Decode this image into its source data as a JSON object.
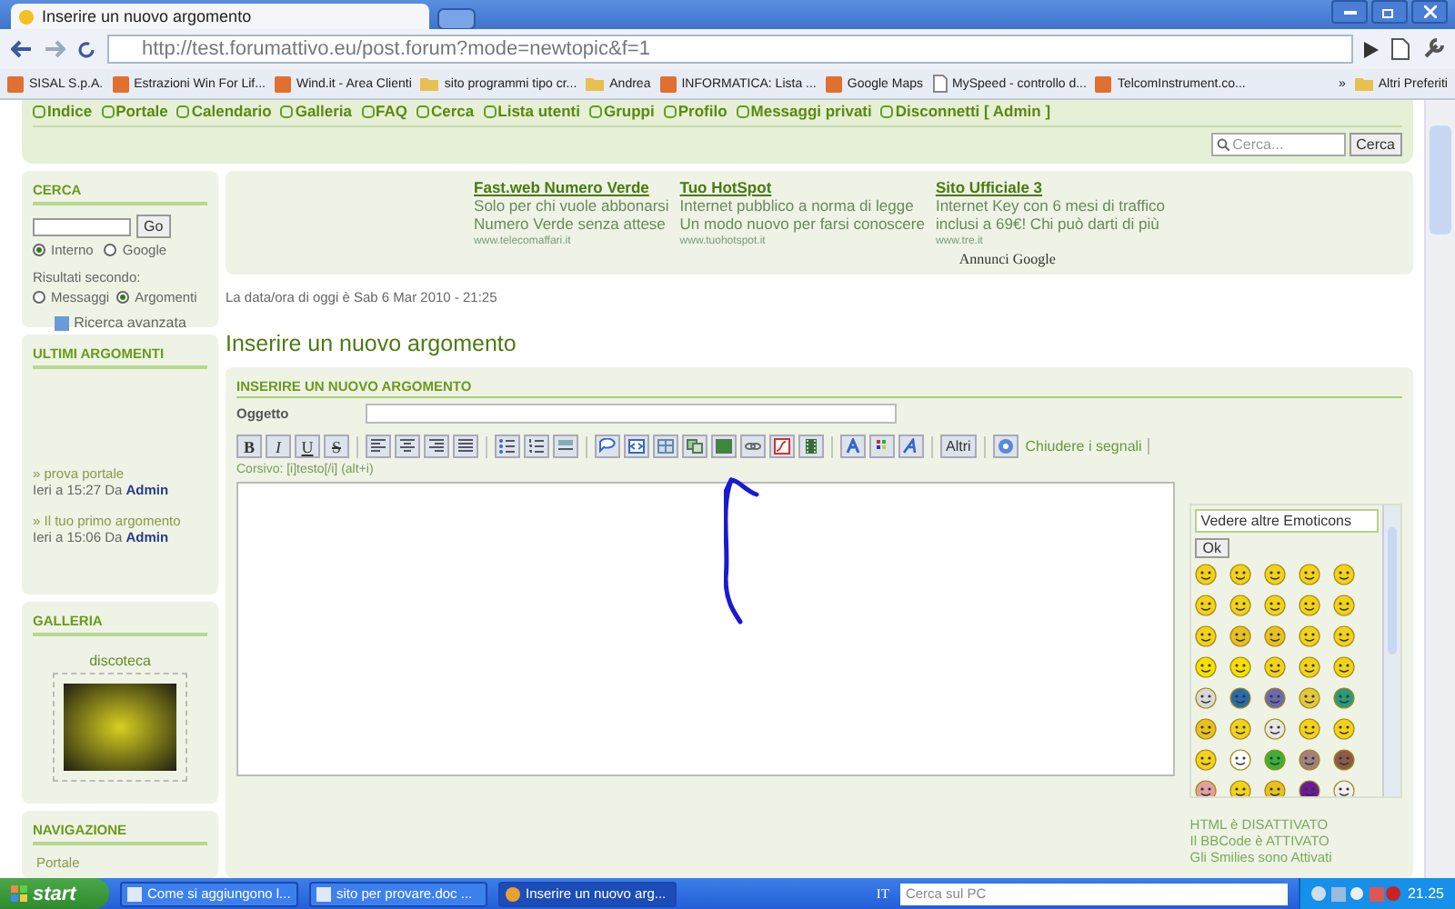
{
  "browser": {
    "tab_title": "Inserire un nuovo argomento",
    "url": "http://test.forumattivo.eu/post.forum?mode=newtopic&f=1",
    "bookmarks": [
      {
        "label": "SISAL S.p.A.",
        "kind": "site"
      },
      {
        "label": "Estrazioni Win For Lif...",
        "kind": "site"
      },
      {
        "label": "Wind.it - Area Clienti",
        "kind": "site"
      },
      {
        "label": "sito programmi tipo cr...",
        "kind": "folder"
      },
      {
        "label": "Andrea",
        "kind": "folder"
      },
      {
        "label": "INFORMATICA: Lista ...",
        "kind": "site"
      },
      {
        "label": "Google Maps",
        "kind": "site"
      },
      {
        "label": "MySpeed - controllo d...",
        "kind": "page"
      },
      {
        "label": "TelcomInstrument.co...",
        "kind": "site"
      }
    ],
    "more": "»",
    "other_bookmarks": "Altri Preferiti"
  },
  "nav": {
    "links": [
      "Indice",
      "Portale",
      "Calendario",
      "Galleria",
      "FAQ",
      "Cerca",
      "Lista utenti",
      "Gruppi",
      "Profilo",
      "Messaggi privati",
      "Disconnetti [ Admin ]"
    ],
    "search": {
      "placeholder": "Cerca...",
      "button": "Cerca"
    }
  },
  "sidebar": {
    "search": {
      "title": "CERCA",
      "button": "Go",
      "engines": [
        {
          "label": "Interno",
          "selected": true
        },
        {
          "label": "Google",
          "selected": false
        }
      ],
      "results_label": "Risultati secondo:",
      "modes": [
        {
          "label": "Messaggi",
          "selected": false
        },
        {
          "label": "Argomenti",
          "selected": true
        }
      ],
      "advanced": "Ricerca avanzata"
    },
    "latest": {
      "title": "ULTIMI ARGOMENTI",
      "items": [
        {
          "topic": "» prova portale",
          "when": "Ieri a 15:27 Da",
          "author": "Admin"
        },
        {
          "topic": "» Il tuo primo argomento",
          "when": "Ieri a 15:06 Da",
          "author": "Admin"
        }
      ]
    },
    "gallery": {
      "title": "GALLERIA",
      "caption": "discoteca"
    },
    "navigation": {
      "title": "NAVIGAZIONE",
      "items": [
        "Portale"
      ]
    }
  },
  "ads": {
    "items": [
      {
        "title": "Fast.web Numero Verde",
        "line1": "Solo per chi vuole abbonarsi",
        "line2": "Numero Verde senza attese",
        "url": "www.telecomaffari.it"
      },
      {
        "title": "Tuo HotSpot",
        "line1": "Internet pubblico a norma di legge",
        "line2": "Un modo nuovo per farsi conoscere",
        "url": "www.tuohotspot.it"
      },
      {
        "title": "Sito Ufficiale 3",
        "line1": "Internet Key con 6 mesi di traffico",
        "line2": "inclusi a 69€! Chi può darti di più",
        "url": "www.tre.it"
      }
    ],
    "label": "Annunci Google"
  },
  "date_line": "La data/ora di oggi è Sab 6 Mar 2010 - 21:25",
  "heading": "Inserire un nuovo argomento",
  "form": {
    "section_title": "INSERIRE UN NUOVO ARGOMENTO",
    "subject_label": "Oggetto",
    "toolbar": [
      {
        "kind": "text",
        "label": "B"
      },
      {
        "kind": "text",
        "label": "I"
      },
      {
        "kind": "text",
        "label": "U"
      },
      {
        "kind": "text",
        "label": "S"
      },
      {
        "kind": "separator"
      },
      {
        "kind": "icon"
      },
      {
        "kind": "icon"
      },
      {
        "kind": "icon"
      },
      {
        "kind": "icon"
      },
      {
        "kind": "separator"
      },
      {
        "kind": "icon"
      },
      {
        "kind": "icon"
      },
      {
        "kind": "icon"
      },
      {
        "kind": "separator"
      },
      {
        "kind": "icon"
      },
      {
        "kind": "icon"
      },
      {
        "kind": "icon"
      },
      {
        "kind": "icon"
      },
      {
        "kind": "icon"
      },
      {
        "kind": "icon"
      },
      {
        "kind": "icon"
      },
      {
        "kind": "icon"
      },
      {
        "kind": "separator"
      },
      {
        "kind": "icon"
      },
      {
        "kind": "icon"
      },
      {
        "kind": "icon"
      },
      {
        "kind": "separator"
      },
      {
        "kind": "text",
        "label": "Altri"
      },
      {
        "kind": "separator"
      },
      {
        "kind": "icon"
      },
      {
        "kind": "link",
        "label": "Chiudere i segnali"
      }
    ],
    "hint": "Corsivo: [i]testo[/i] (alt+i)",
    "emoticon_select": "Vedere altre Emoticons",
    "emoticon_ok": "Ok",
    "emoticons": [
      {
        "color": "#f2d21a"
      },
      {
        "color": "#f2d21a"
      },
      {
        "color": "#f2d21a"
      },
      {
        "color": "#f2d21a"
      },
      {
        "color": "#f2d21a"
      },
      {
        "color": "#f2d21a"
      },
      {
        "color": "#f2d21a"
      },
      {
        "color": "#f2d21a"
      },
      {
        "color": "#f2d21a"
      },
      {
        "color": "#f2d21a"
      },
      {
        "color": "#f2d21a"
      },
      {
        "color": "#e8c020"
      },
      {
        "color": "#e8c020"
      },
      {
        "color": "#f2d21a"
      },
      {
        "color": "#f2d21a"
      },
      {
        "color": "#f7e000"
      },
      {
        "color": "#f7e000"
      },
      {
        "color": "#f2d21a"
      },
      {
        "color": "#f2d21a"
      },
      {
        "color": "#f2d21a"
      },
      {
        "color": "#d8d8d8"
      },
      {
        "color": "#2a6aa8"
      },
      {
        "color": "#6a6ab0"
      },
      {
        "color": "#e0c83a"
      },
      {
        "color": "#2a9a7a"
      },
      {
        "color": "#e8c020"
      },
      {
        "color": "#f2d21a"
      },
      {
        "color": "#e6e6e6"
      },
      {
        "color": "#f2d21a"
      },
      {
        "color": "#f2d21a"
      },
      {
        "color": "#f2d21a"
      },
      {
        "color": "#ffffff"
      },
      {
        "color": "#3ab03a"
      },
      {
        "color": "#a08080"
      },
      {
        "color": "#8a5a4a"
      },
      {
        "color": "#e0a0a0"
      },
      {
        "color": "#f2d21a"
      },
      {
        "color": "#e8c020"
      },
      {
        "color": "#6a1a9a"
      },
      {
        "color": "#f0f0f0"
      }
    ],
    "status": [
      "HTML è DISATTIVATO",
      "Il BBCode è ATTIVATO",
      "Gli Smilies sono Attivati"
    ]
  },
  "taskbar": {
    "start": "start",
    "tasks": [
      {
        "label": "Come si aggiungono l...",
        "kind": "document",
        "selected": false
      },
      {
        "label": "sito per provare.doc ...",
        "kind": "document",
        "selected": false
      },
      {
        "label": "Inserire un nuovo arg...",
        "kind": "browser",
        "selected": true
      }
    ],
    "language": "IT",
    "search_placeholder": "Cerca sul PC",
    "clock": "21.25"
  }
}
